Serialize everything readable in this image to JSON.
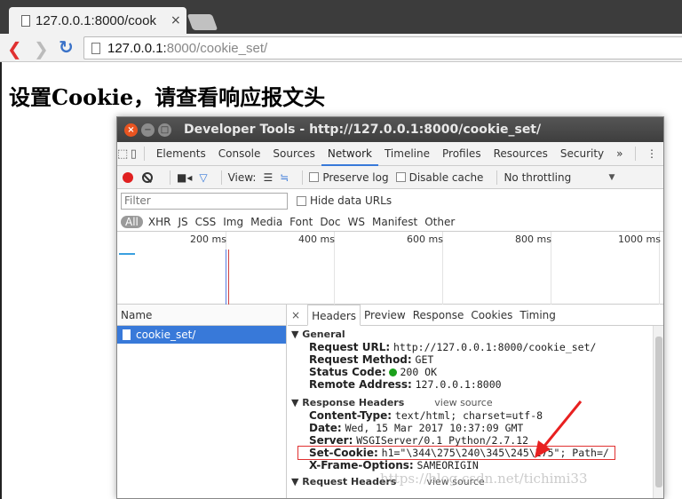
{
  "browser": {
    "tab_title": "127.0.0.1:8000/cook",
    "tab_close": "×",
    "url_host": "127.0.0.1:",
    "url_path": "8000/cookie_set/"
  },
  "page": {
    "heading": "设置Cookie，请查看响应报文头"
  },
  "devtools": {
    "window_title": "Developer Tools - http://127.0.0.1:8000/cookie_set/",
    "tabs": [
      "Elements",
      "Console",
      "Sources",
      "Network",
      "Timeline",
      "Profiles",
      "Resources",
      "Security"
    ],
    "tabs_more": "»",
    "tabs_menu": "⋮",
    "toolbar": {
      "view_label": "View:",
      "preserve_log": "Preserve log",
      "disable_cache": "Disable cache",
      "throttling": "No throttling",
      "throttling_arrow": "▼"
    },
    "filter_placeholder": "Filter",
    "hide_data_urls": "Hide data URLs",
    "types": [
      "All",
      "XHR",
      "JS",
      "CSS",
      "Img",
      "Media",
      "Font",
      "Doc",
      "WS",
      "Manifest",
      "Other"
    ],
    "timeline_ticks": [
      "200 ms",
      "400 ms",
      "600 ms",
      "800 ms",
      "1000 ms"
    ],
    "name_column": "Name",
    "request_name": "cookie_set/",
    "detail_close": "×",
    "detail_tabs": [
      "Headers",
      "Preview",
      "Response",
      "Cookies",
      "Timing"
    ],
    "general": {
      "heading": "▼ General",
      "request_url_k": "Request URL:",
      "request_url_v": "http://127.0.0.1:8000/cookie_set/",
      "request_method_k": "Request Method:",
      "request_method_v": "GET",
      "status_code_k": "Status Code:",
      "status_code_v": "200 OK",
      "remote_address_k": "Remote Address:",
      "remote_address_v": "127.0.0.1:8000"
    },
    "response_headers": {
      "heading": "▼ Response Headers",
      "view_source": "view source",
      "content_type_k": "Content-Type:",
      "content_type_v": "text/html; charset=utf-8",
      "date_k": "Date:",
      "date_v": "Wed, 15 Mar 2017 10:37:09 GMT",
      "server_k": "Server:",
      "server_v": "WSGIServer/0.1 Python/2.7.12",
      "set_cookie_k": "Set-Cookie:",
      "set_cookie_v": "h1=\"\\344\\275\\240\\345\\245\\275\"; Path=/",
      "xframe_k": "X-Frame-Options:",
      "xframe_v": "SAMEORIGIN"
    },
    "request_headers": {
      "heading": "▼ Request Headers",
      "view_source": "view source"
    }
  },
  "watermark": "https://blog.csdn.net/tichimi33",
  "colors": {
    "accent": "#3879d9",
    "record": "#e02020",
    "status_ok": "#1ca01c",
    "highlight": "#e03030"
  }
}
